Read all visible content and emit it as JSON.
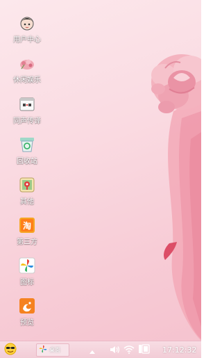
{
  "desktop": {
    "icons": [
      {
        "label": "用户中心",
        "icon": "user-center-icon"
      },
      {
        "label": "休闲娱乐",
        "icon": "leisure-icon"
      },
      {
        "label": "同声传译",
        "icon": "translator-icon"
      },
      {
        "label": "回收站",
        "icon": "recycle-bin-icon"
      },
      {
        "label": "其他",
        "icon": "other-icon"
      },
      {
        "label": "第三方",
        "icon": "taobao-icon"
      },
      {
        "label": "图标",
        "icon": "pinwheel-icon"
      },
      {
        "label": "预览",
        "icon": "uc-browser-icon"
      }
    ]
  },
  "taskbar": {
    "start_icon": "emoji-start-icon",
    "task_label": "桌面",
    "clock": "17:12:32"
  },
  "colors": {
    "wallpaper": "#fadbe2",
    "taskbar": "#f5d3dc",
    "accent": "#e2707f"
  }
}
